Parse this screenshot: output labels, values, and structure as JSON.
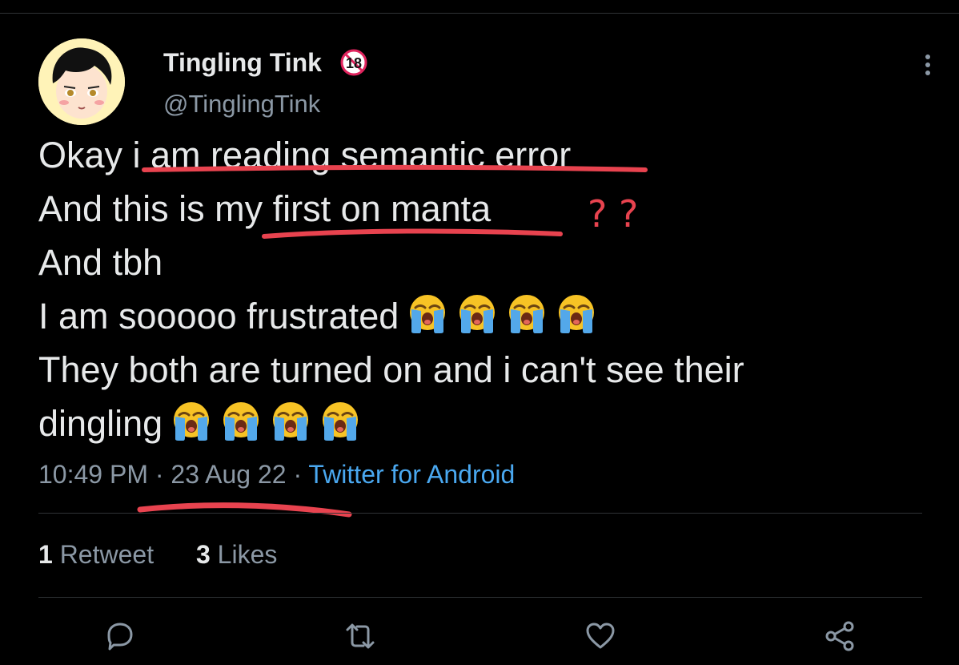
{
  "author": {
    "display_name": "Tingling Tink",
    "age_badge": "18",
    "handle": "@TinglingTink"
  },
  "tweet": {
    "lines": [
      "Okay i am reading semantic error",
      "And this is my first on manta",
      "And tbh",
      "I am sooooo frustrated",
      "They both are turned on and i can't see their",
      "dingling"
    ],
    "emoji": "loudly-crying-face",
    "emoji_counts": [
      0,
      0,
      0,
      4,
      0,
      4
    ]
  },
  "meta": {
    "time": "10:49 PM",
    "separator": " · ",
    "date": "23 Aug 22",
    "source": "Twitter for Android"
  },
  "stats": {
    "retweets_count": "1",
    "retweets_label": "Retweet",
    "likes_count": "3",
    "likes_label": "Likes"
  },
  "annotation": {
    "marks": "? ?",
    "color": "#e8434f"
  },
  "actions": [
    "reply-icon",
    "retweet-icon",
    "like-icon",
    "share-icon"
  ],
  "colors": {
    "background": "#000000",
    "text": "#e7e9ea",
    "muted": "#8b98a5",
    "link": "#4aa8f0",
    "divider": "#2f3336"
  }
}
